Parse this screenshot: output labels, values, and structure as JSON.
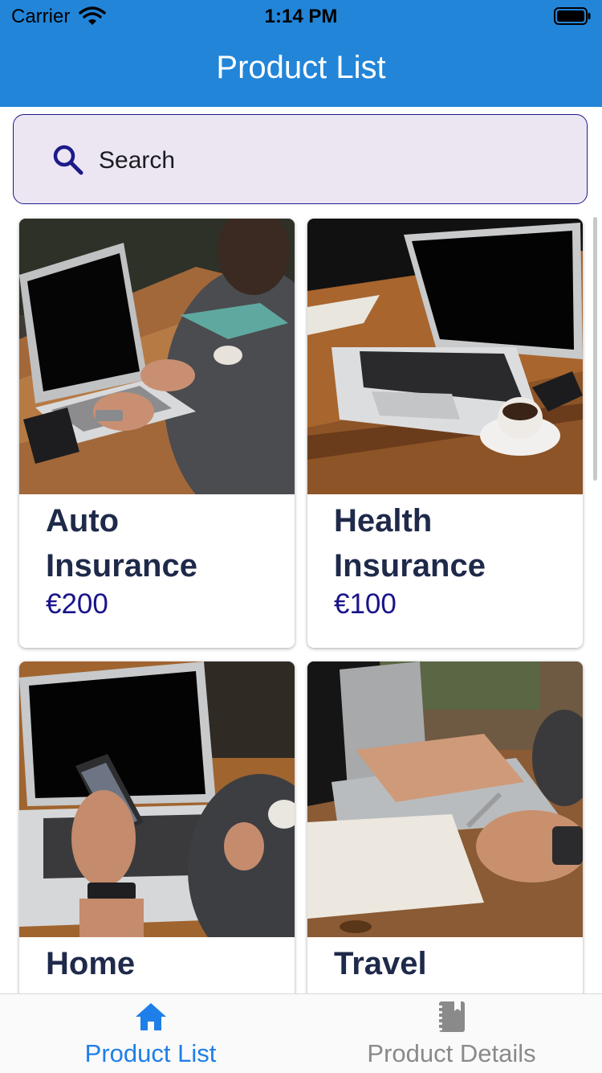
{
  "status_bar": {
    "carrier": "Carrier",
    "time": "1:14 PM"
  },
  "nav": {
    "title": "Product List"
  },
  "search": {
    "placeholder": "Search"
  },
  "products": [
    {
      "title": "Auto Insurance",
      "price": "€200",
      "image": "photo of a man typing on a laptop at a wooden table"
    },
    {
      "title": "Health Insurance",
      "price": "€100",
      "image": "photo of a laptop and a coffee cup on a wooden table"
    },
    {
      "title": "Home Insurance",
      "price": "",
      "image": "photo of a hand holding a phone in front of a laptop"
    },
    {
      "title": "Travel Insurance",
      "price": "",
      "image": "photo of a hand writing in a notebook"
    }
  ],
  "tabs": [
    {
      "label": "Product List",
      "icon": "home-icon",
      "active": true
    },
    {
      "label": "Product Details",
      "icon": "notebook-icon",
      "active": false
    }
  ],
  "colors": {
    "header": "#2285d8",
    "tab_active": "#1f7fe8",
    "tab_inactive": "#8a8a8a",
    "title_text": "#1f2a4a",
    "price_text": "#1a148a"
  }
}
